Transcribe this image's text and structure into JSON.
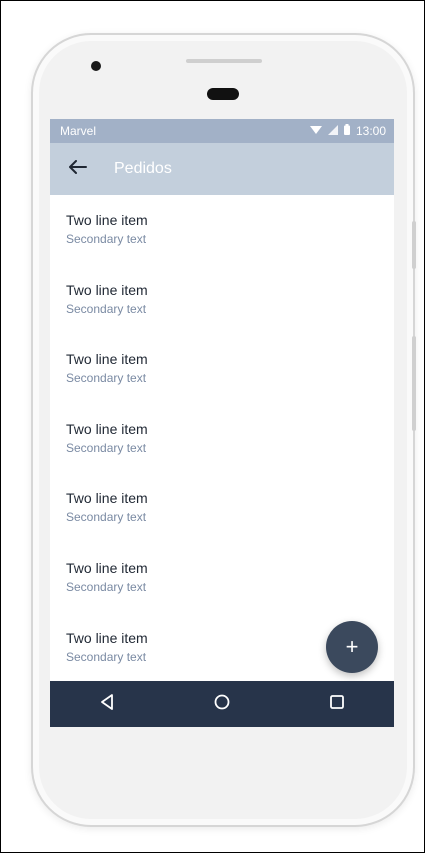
{
  "status_bar": {
    "carrier": "Marvel",
    "time": "13:00",
    "icons": [
      "wifi-icon",
      "signal-icon",
      "battery-icon"
    ]
  },
  "app_bar": {
    "title": "Pedidos",
    "back_icon": "arrow-left-icon"
  },
  "list": {
    "items": [
      {
        "primary": "Two line item",
        "secondary": "Secondary text"
      },
      {
        "primary": "Two line item",
        "secondary": "Secondary text"
      },
      {
        "primary": "Two line item",
        "secondary": "Secondary text"
      },
      {
        "primary": "Two line item",
        "secondary": "Secondary text"
      },
      {
        "primary": "Two line item",
        "secondary": "Secondary text"
      },
      {
        "primary": "Two line item",
        "secondary": "Secondary text"
      },
      {
        "primary": "Two line item",
        "secondary": "Secondary text"
      }
    ]
  },
  "fab": {
    "label": "+",
    "icon": "plus-icon"
  },
  "nav_bar": {
    "buttons": [
      "back-triangle-icon",
      "home-circle-icon",
      "recents-square-icon"
    ]
  },
  "colors": {
    "status_bar": "#a2b1c7",
    "app_bar": "#c3cfdc",
    "fab": "#3b495d",
    "nav_bar": "#27344a",
    "secondary_text": "#7a8aa3"
  }
}
